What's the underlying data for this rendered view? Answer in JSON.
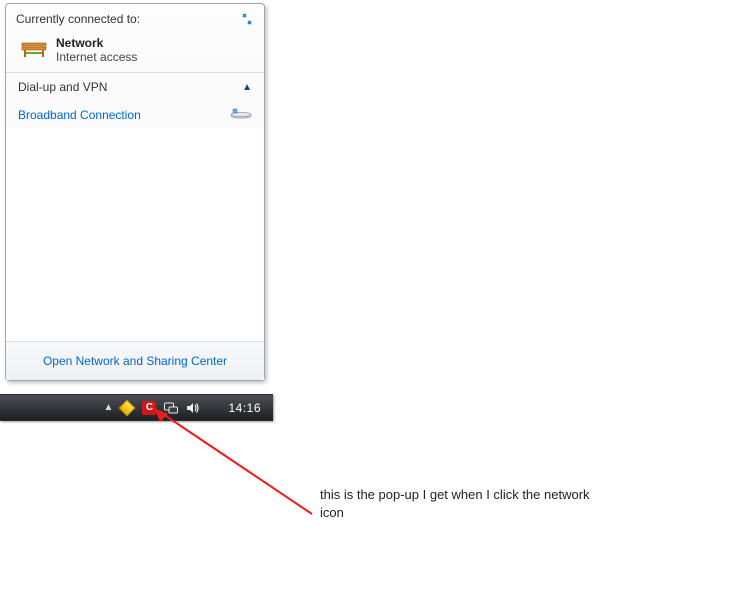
{
  "popup": {
    "header": "Currently connected to:",
    "network": {
      "name": "Network",
      "status": "Internet access"
    },
    "section_dialup": "Dial-up and VPN",
    "broadband": "Broadband Connection",
    "footer": "Open Network and Sharing Center"
  },
  "taskbar": {
    "clock": "14:16",
    "comodo_letter": "C"
  },
  "annotation": {
    "text": "this is the pop-up I get when I click the network icon"
  }
}
